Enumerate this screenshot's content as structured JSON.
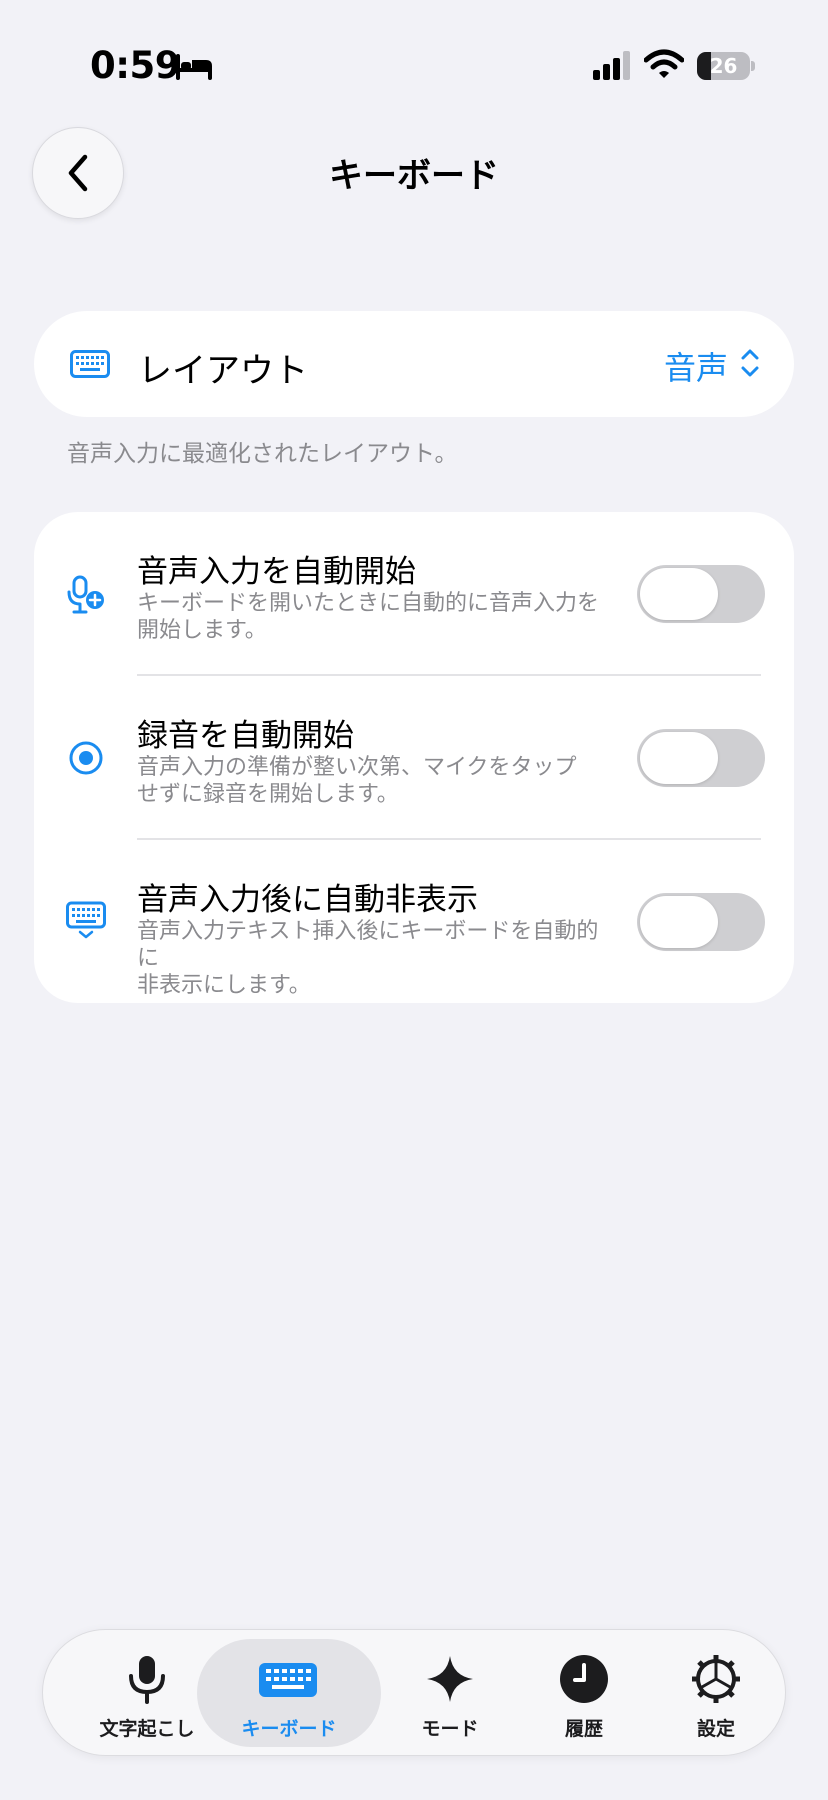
{
  "status_bar": {
    "time": "0:59",
    "battery": "26",
    "battery_level": 0.26
  },
  "header": {
    "title": "キーボード"
  },
  "layout_setting": {
    "label": "レイアウト",
    "value": "音声",
    "footnote": "音声入力に最適化されたレイアウト。"
  },
  "options": [
    {
      "title": "音声入力を自動開始",
      "desc_line1": "キーボードを開いたときに自動的に音声入力を",
      "desc_line2": "開始します。",
      "enabled": false,
      "icon": "mic-plus-icon"
    },
    {
      "title": "録音を自動開始",
      "desc_line1": "音声入力の準備が整い次第、マイクをタップ",
      "desc_line2": "せずに録音を開始します。",
      "enabled": false,
      "icon": "record-icon"
    },
    {
      "title": "音声入力後に自動非表示",
      "desc_line1": "音声入力テキスト挿入後にキーボードを自動的に",
      "desc_line2": "非表示にします。",
      "enabled": false,
      "icon": "keyboard-hide-icon"
    }
  ],
  "tab_bar": {
    "selected": "keyboard",
    "tabs": [
      {
        "id": "transcribe",
        "label": "文字起こし",
        "icon": "microphone-icon"
      },
      {
        "id": "keyboard",
        "label": "キーボード",
        "icon": "keyboard-icon"
      },
      {
        "id": "mode",
        "label": "モード",
        "icon": "sparkle-icon"
      },
      {
        "id": "history",
        "label": "履歴",
        "icon": "clock-icon"
      },
      {
        "id": "settings",
        "label": "設定",
        "icon": "gear-icon"
      }
    ]
  },
  "colors": {
    "accent": "#1A8CF0",
    "background": "#F2F2F7",
    "secondary_text": "#8A8A8E",
    "toggle_off": "#CFCFD2"
  }
}
